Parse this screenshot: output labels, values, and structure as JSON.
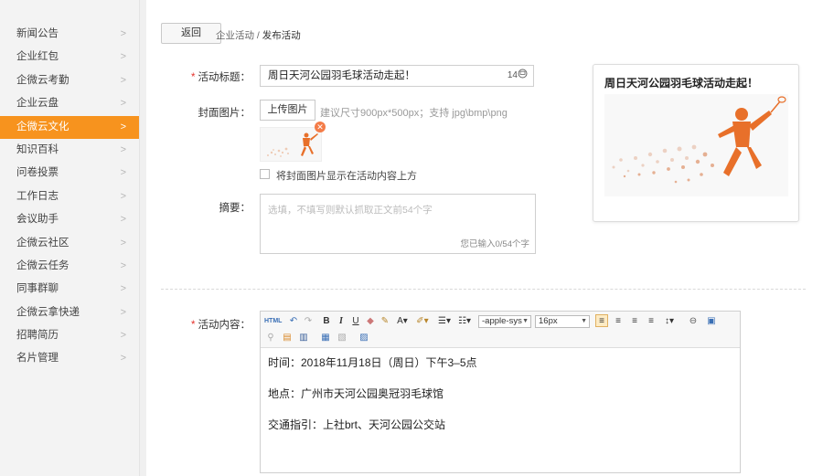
{
  "sidebar": {
    "items": [
      {
        "label": "新闻公告",
        "active": false
      },
      {
        "label": "企业红包",
        "active": false
      },
      {
        "label": "企微云考勤",
        "active": false
      },
      {
        "label": "企业云盘",
        "active": false
      },
      {
        "label": "企微云文化",
        "active": true
      },
      {
        "label": "知识百科",
        "active": false
      },
      {
        "label": "问卷投票",
        "active": false
      },
      {
        "label": "工作日志",
        "active": false
      },
      {
        "label": "会议助手",
        "active": false
      },
      {
        "label": "企微云社区",
        "active": false
      },
      {
        "label": "企微云任务",
        "active": false
      },
      {
        "label": "同事群聊",
        "active": false
      },
      {
        "label": "企微云拿快递",
        "active": false
      },
      {
        "label": "招聘简历",
        "active": false
      },
      {
        "label": "名片管理",
        "active": false
      }
    ],
    "chevron": ">"
  },
  "header": {
    "back_label": "返回",
    "breadcrumb_parent": "企业活动",
    "breadcrumb_sep": " / ",
    "breadcrumb_current": "发布活动"
  },
  "form": {
    "title_label": "活动标题：",
    "title_value": "周日天河公园羽毛球活动走起！",
    "title_count": "14",
    "cover_label": "封面图片：",
    "upload_label": "上传图片",
    "cover_hint": "建议尺寸900px*500px；支持 jpg\\bmp\\png",
    "show_cover_label": "将封面图片显示在活动内容上方",
    "summary_label": "摘要：",
    "summary_placeholder": "选填，不填写则默认抓取正文前54个字",
    "summary_count": "您已输入0/54个字",
    "content_label": "活动内容：",
    "required_mark": "*"
  },
  "preview": {
    "title": "周日天河公园羽毛球活动走起！"
  },
  "editor": {
    "font_family": "-apple-sys",
    "font_size": "16px",
    "lines": [
      "时间：2018年11月18日（周日）下午3–5点",
      "地点：广州市天河公园奥冠羽毛球馆",
      "交通指引：上社brt、天河公园公交站"
    ]
  },
  "colors": {
    "accent": "#f7931e",
    "required": "#e5322d"
  }
}
